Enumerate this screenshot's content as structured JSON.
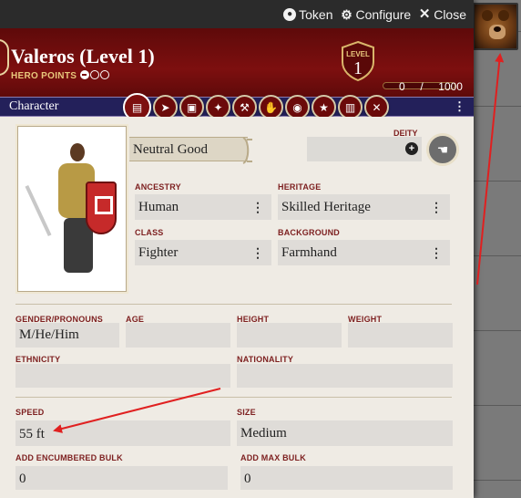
{
  "window": {
    "header_buttons": {
      "token": "Token",
      "configure": "Configure",
      "close": "Close"
    }
  },
  "character": {
    "name": "Valeros (Level 1)",
    "hero_points_label": "HERO POINTS",
    "level_label": "LEVEL",
    "level": "1",
    "xp_current": "0",
    "xp_separator": "/",
    "xp_max": "1000"
  },
  "tabs": {
    "title": "Character",
    "icons": [
      "id-card-icon",
      "arrow-icon",
      "inventory-icon",
      "wand-icon",
      "hammer-icon",
      "hand-icon",
      "medal-icon",
      "star-icon",
      "book-icon",
      "scale-icon"
    ],
    "more": "⋮"
  },
  "bio": {
    "alignment": "Neutral Good",
    "deity_label": "DEITY",
    "ancestry_label": "ANCESTRY",
    "ancestry": "Human",
    "heritage_label": "HERITAGE",
    "heritage": "Skilled Heritage",
    "class_label": "CLASS",
    "class": "Fighter",
    "background_label": "BACKGROUND",
    "background": "Farmhand",
    "gender_label": "GENDER/PRONOUNS",
    "gender": "M/He/Him",
    "age_label": "AGE",
    "age": "",
    "height_label": "HEIGHT",
    "height": "",
    "weight_label": "WEIGHT",
    "weight": "",
    "ethnicity_label": "ETHNICITY",
    "ethnicity": "",
    "nationality_label": "NATIONALITY",
    "nationality": "",
    "speed_label": "SPEED",
    "speed": "55 ft",
    "size_label": "SIZE",
    "size": "Medium",
    "add_encumbered_label": "ADD ENCUMBERED BULK",
    "add_encumbered": "0",
    "add_max_label": "ADD MAX BULK",
    "add_max": "0"
  },
  "colors": {
    "banner": "#7d0f0f",
    "tabbar": "#23205a",
    "label": "#7d1f1f",
    "annotation_arrow": "#e02020"
  }
}
